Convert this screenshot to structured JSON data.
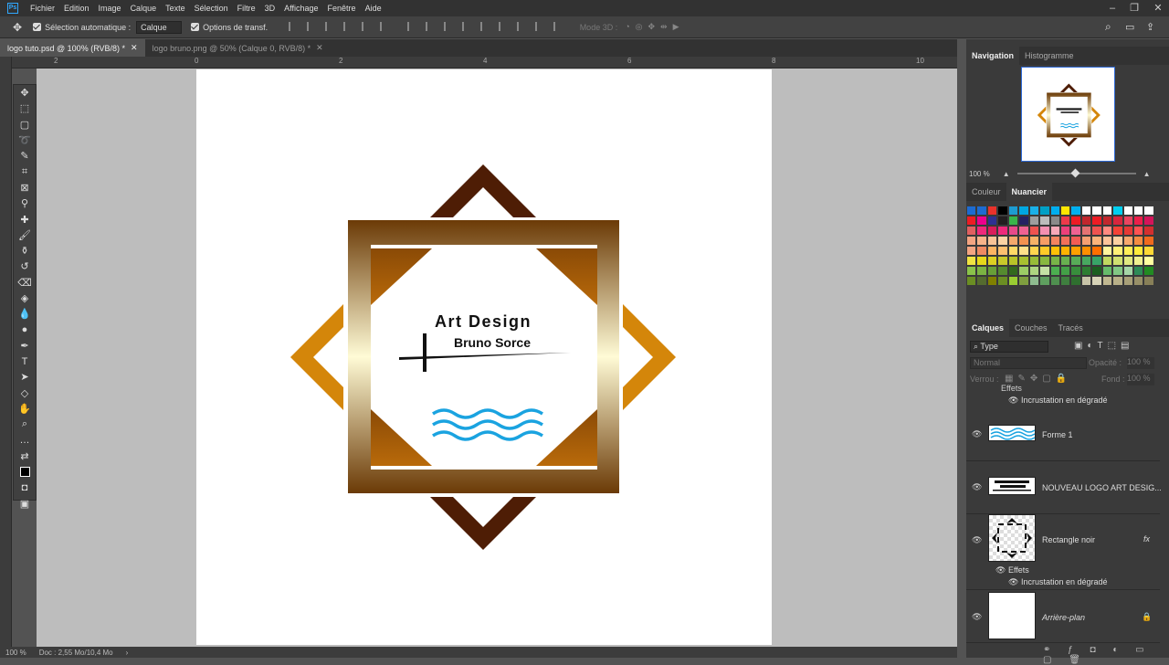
{
  "menu": {
    "items": [
      "Fichier",
      "Edition",
      "Image",
      "Calque",
      "Texte",
      "Sélection",
      "Filtre",
      "3D",
      "Affichage",
      "Fenêtre",
      "Aide"
    ]
  },
  "options": {
    "auto_select_label": "Sélection automatique :",
    "auto_select_value": "Calque",
    "transform_label": "Options de transf.",
    "mode3d_label": "Mode 3D :"
  },
  "tabs": [
    {
      "label": "logo tuto.psd @ 100% (RVB/8) *"
    },
    {
      "label": "logo bruno.png @ 50% (Calque 0, RVB/8) *"
    }
  ],
  "ruler": {
    "ticks": [
      "2",
      "0",
      "2",
      "4",
      "6",
      "8",
      "10"
    ]
  },
  "canvas": {
    "logo_title": "Art Design",
    "logo_subtitle": "Bruno Sorce"
  },
  "status": {
    "zoom": "100 %",
    "doc": "Doc : 2,55 Mo/10,4 Mo"
  },
  "navigator": {
    "tabs": [
      "Navigation",
      "Histogramme"
    ],
    "zoom": "100 %"
  },
  "swatches": {
    "tabs": [
      "Couleur",
      "Nuancier"
    ]
  },
  "layers": {
    "tabs": [
      "Calques",
      "Couches",
      "Tracés"
    ],
    "filter_label": "Type",
    "blend_mode": "Normal",
    "opacity_label": "Opacité :",
    "opacity_value": "100 %",
    "lock_label": "Verrou :",
    "fill_label": "Fond :",
    "fill_value": "100 %",
    "top_effects_label": "Effets",
    "top_effect": "Incrustation en dégradé",
    "items": [
      {
        "name": "Forme 1"
      },
      {
        "name": "NOUVEAU LOGO ART DESIG..."
      },
      {
        "name": "Rectangle noir",
        "fx": "fx",
        "effects_label": "Effets",
        "effect": "Incrustation en dégradé"
      },
      {
        "name": "Arrière-plan"
      }
    ]
  },
  "colors": {
    "accent": "#31a8ff",
    "gold_light": "#fffbd6",
    "gold_dark": "#6b3a06",
    "brown": "#4e1d05",
    "orange": "#d4860a",
    "wave": "#1aa3e0"
  }
}
